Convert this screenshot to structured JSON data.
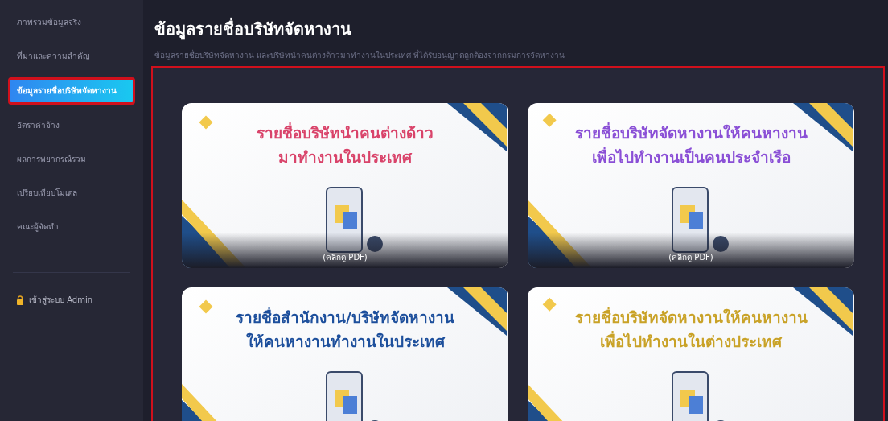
{
  "sidebar": {
    "items": [
      {
        "label": "ภาพรวมข้อมูลจริง",
        "selected": false
      },
      {
        "label": "ที่มาและความสำคัญ",
        "selected": false
      },
      {
        "label": "ข้อมูลรายชื่อบริษัทจัดหางาน",
        "selected": true
      },
      {
        "label": "อัตราค่าจ้าง",
        "selected": false
      },
      {
        "label": "ผลการพยากรณ์รวม",
        "selected": false
      },
      {
        "label": "เปรียบเทียบโมเดล",
        "selected": false
      },
      {
        "label": "คณะผู้จัดทำ",
        "selected": false
      }
    ],
    "admin_link": "เข้าสู่ระบบ Admin"
  },
  "page": {
    "title": "ข้อมูลรายชื่อบริษัทจัดหางาน",
    "subtitle": "ข้อมูลรายชื่อบริษัทจัดหางาน และบริษัทนำคนต่างด้าวมาทำงานในประเทศ ที่ได้รับอนุญาตถูกต้องจากกรมการจัดหางาน"
  },
  "cards": [
    {
      "title_lines": [
        "รายชื่อบริษัทนำคนต่างด้าว",
        "มาทำงานในประเทศ"
      ],
      "color": "#d9436a",
      "caption": "(คลิกดู PDF)"
    },
    {
      "title_lines": [
        "รายชื่อบริษัทจัดหางานให้คนหางาน",
        "เพื่อไปทำงานเป็นคนประจำเรือ"
      ],
      "color": "#8a4fd6",
      "caption": "(คลิกดู PDF)"
    },
    {
      "title_lines": [
        "รายชื่อสำนักงาน/บริษัทจัดหางาน",
        "ให้คนหางานทำงานในประเทศ"
      ],
      "color": "#1d4f9c"
    },
    {
      "title_lines": [
        "รายชื่อบริษัทจัดหางานให้คนหางาน",
        "เพื่อไปทำงานในต่างประเทศ"
      ],
      "color": "#c9a227"
    }
  ]
}
